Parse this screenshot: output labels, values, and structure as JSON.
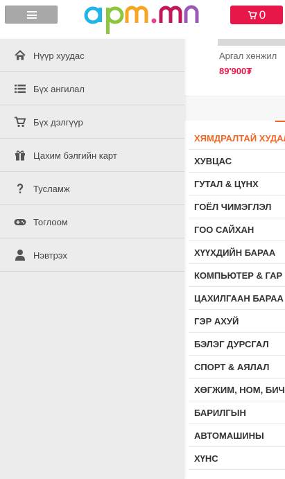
{
  "header": {
    "menu_icon": "hamburger-icon",
    "logo_text": "apm.mn",
    "cart_icon": "shopping-cart-icon",
    "cart_count": "0",
    "colors": {
      "cart": "#e8174a",
      "menu": "#a8a8a8"
    }
  },
  "sidenav": {
    "items": [
      {
        "label": "Нүүр хуудас",
        "icon": "home-icon"
      },
      {
        "label": "Бүх ангилал",
        "icon": "list-icon"
      },
      {
        "label": "Бүх дэлгүүр",
        "icon": "cart-icon"
      },
      {
        "label": "Цахим бэлгийн карт",
        "icon": "gift-icon"
      },
      {
        "label": "Тусламж",
        "icon": "question-icon"
      },
      {
        "label": "Тоглоом",
        "icon": "gamepad-icon"
      },
      {
        "label": "Нэвтрэх",
        "icon": "user-icon"
      }
    ]
  },
  "product": {
    "name": "Аргал хөнжил",
    "price": "89'900₮"
  },
  "categories": {
    "items": [
      "ХЯМДРАЛТАЙ ХУДАЛДАА",
      "ХУВЦАС",
      "ГУТАЛ & ЦҮНХ",
      "ГОЁЛ ЧИМЭГЛЭЛ",
      "ГОО САЙХАН",
      "ХҮҮХДИЙН БАРАА",
      "КОМПЬЮТЕР & ГАР УТАС",
      "ЦАХИЛГААН БАРАА",
      "ГЭР АХУЙ",
      "БЭЛЭГ ДУРСГАЛ",
      "СПОРТ & АЯЛАЛ",
      "ХӨГЖИМ, НОМ, БИЧИГ ХЭРЭГ",
      "БАРИЛГЫН",
      "АВТОМАШИНЫ",
      "ХҮНС"
    ],
    "active_color": "#f26522"
  }
}
